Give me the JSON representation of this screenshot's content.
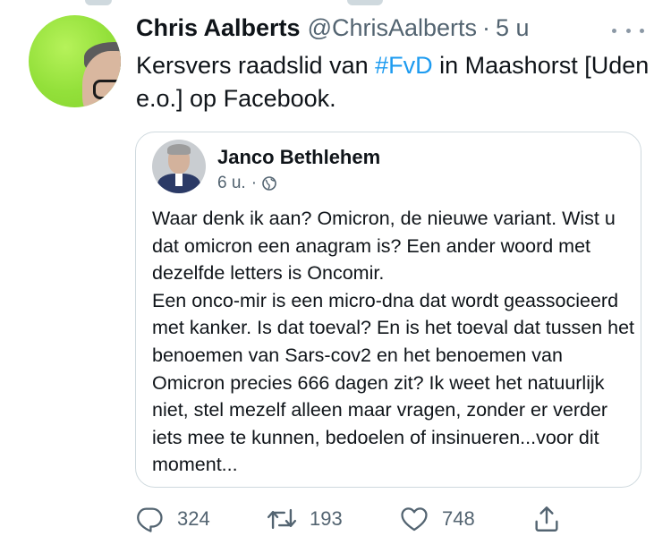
{
  "tweet": {
    "display_name": "Chris Aalberts",
    "handle": "@ChrisAalberts",
    "separator": "·",
    "time": "5 u",
    "text_before": "Kersvers raadslid van ",
    "hashtag": "#FvD",
    "text_after": " in Maashorst [Uden e.o.] op Facebook."
  },
  "quote": {
    "name": "Janco Bethlehem",
    "time": "6 u.",
    "separator": "·",
    "lines": [
      "Waar denk ik aan? Omicron, de nieuwe variant. Wist u dat omicron een anagram is? Een ander woord met dezelfde letters is Oncomir.",
      "Een onco-mir is een micro-dna dat wordt geassocieerd met kanker. Is dat toeval? En is het toeval dat tussen het benoemen van Sars-cov2 en het benoemen van Omicron precies 666 dagen zit? Ik weet het natuurlijk niet, stel mezelf alleen maar vragen, zonder er verder iets mee te kunnen, bedoelen of insinueren...voor dit moment..."
    ]
  },
  "actions": {
    "reply_count": "324",
    "retweet_count": "193",
    "like_count": "748"
  },
  "icons": {
    "more": "more-icon",
    "globe": "globe-icon",
    "reply": "reply-icon",
    "retweet": "retweet-icon",
    "like": "like-icon",
    "share": "share-icon"
  },
  "colors": {
    "text": "#0f1419",
    "secondary": "#536471",
    "link": "#1d9bf0",
    "border": "#cfd9de",
    "avatar_bg": "#93e03a"
  }
}
